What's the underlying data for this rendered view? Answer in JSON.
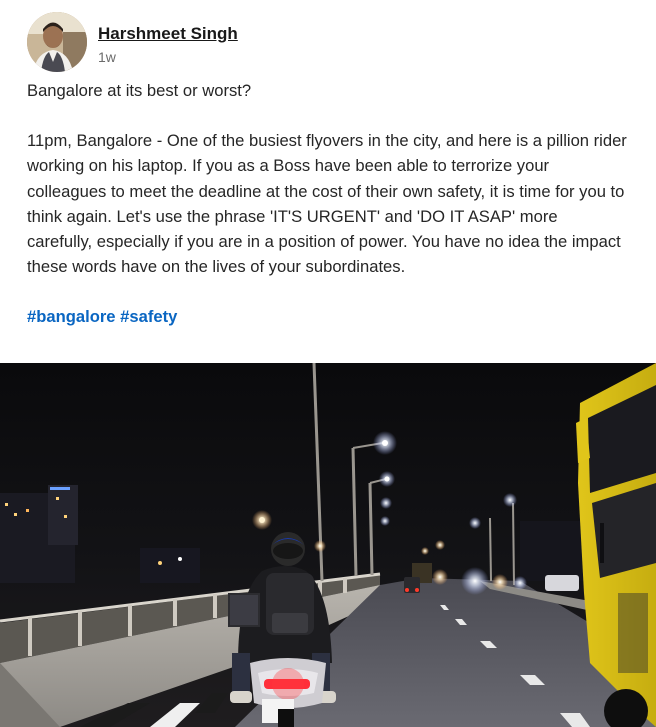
{
  "post": {
    "author": {
      "name": "Harshmeet Singh",
      "time": "1w"
    },
    "headline": "Bangalore at its best or worst?",
    "body": "11pm, Bangalore - One of the busiest flyovers in the city, and here is a pillion rider working on his laptop. If you as a Boss have been able to terrorize your colleagues to meet the deadline at the cost of their own safety, it is time for you to think again. Let's use the phrase 'IT'S URGENT' and 'DO IT ASAP' more carefully, especially if you are in a position of power. You have no idea the impact these words have on the lives of your subordinates.",
    "hashtags": [
      "#bangalore",
      "#safety"
    ]
  },
  "colors": {
    "link": "#0a66c2",
    "text": "#262626",
    "meta": "#6b6b6b"
  }
}
